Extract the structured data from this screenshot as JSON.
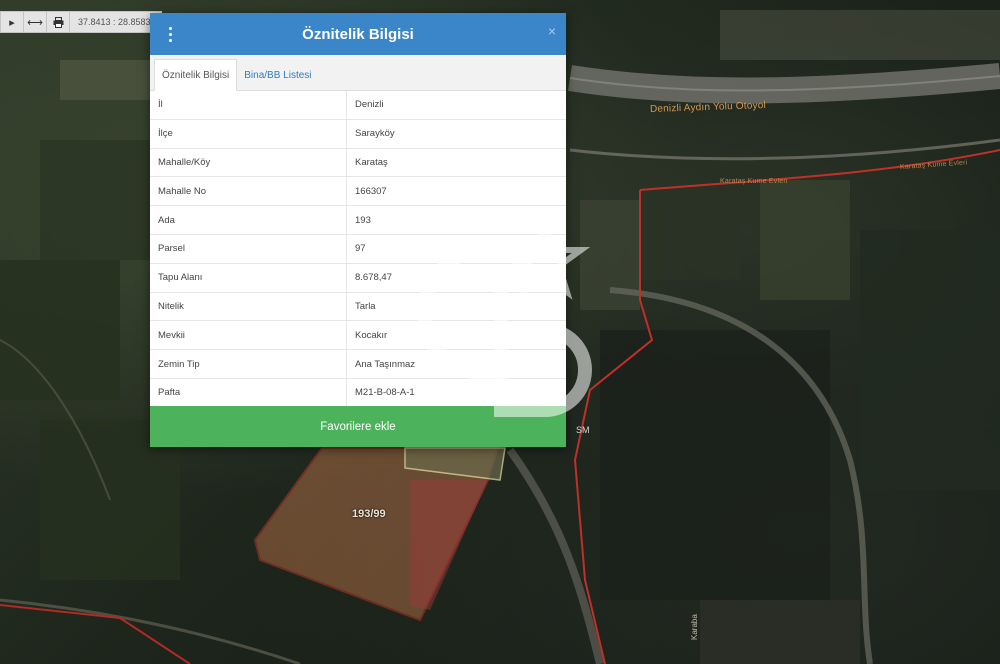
{
  "toolbar": {
    "coords": "37.8413 : 28.8583"
  },
  "map": {
    "road_label": "Denizli Aydın Yolu Otoyol",
    "road_label_small": "Karataş Kume Evleri",
    "road_label_right": "Karataş Kume Evleri",
    "parcel_label": "193/99",
    "sm_label": "SM",
    "kb_label": "Karaba"
  },
  "modal": {
    "title": "Öznitelik Bilgisi",
    "close": "×",
    "tabs": [
      {
        "label": "Öznitelik Bilgisi",
        "active": true
      },
      {
        "label": "Bina/BB Listesi",
        "active": false
      }
    ],
    "rows": [
      {
        "key": "İl",
        "value": "Denizli"
      },
      {
        "key": "İlçe",
        "value": "Sarayköy"
      },
      {
        "key": "Mahalle/Köy",
        "value": "Karataş"
      },
      {
        "key": "Mahalle No",
        "value": "166307"
      },
      {
        "key": "Ada",
        "value": "193"
      },
      {
        "key": "Parsel",
        "value": "97"
      },
      {
        "key": "Tapu Alanı",
        "value": "8.678,47"
      },
      {
        "key": "Nitelik",
        "value": "Tarla"
      },
      {
        "key": "Mevkii",
        "value": "Kocakır"
      },
      {
        "key": "Zemin Tip",
        "value": "Ana Taşınmaz"
      },
      {
        "key": "Pafta",
        "value": "M21-B-08-A-1"
      }
    ],
    "fav_button": "Favorilere ekle"
  },
  "colors": {
    "header": "#3a86c8",
    "fav_button": "#4cb35c",
    "parcel_border": "#c0302a"
  }
}
